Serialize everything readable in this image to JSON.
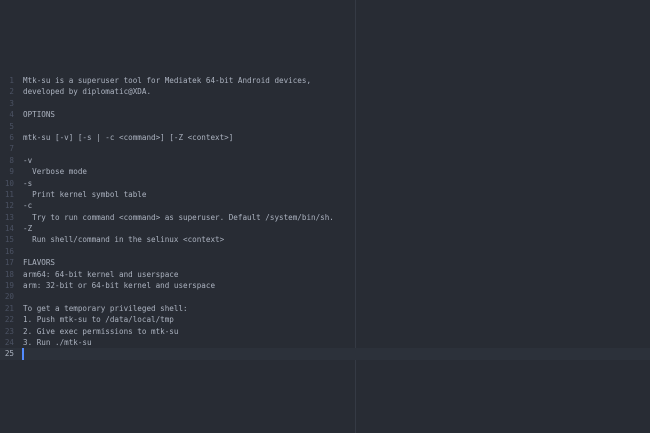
{
  "editor": {
    "lines": [
      {
        "num": "1",
        "text": "Mtk-su is a superuser tool for Mediatek 64-bit Android devices,"
      },
      {
        "num": "2",
        "text": "developed by diplomatic@XDA."
      },
      {
        "num": "3",
        "text": ""
      },
      {
        "num": "4",
        "text": "OPTIONS"
      },
      {
        "num": "5",
        "text": ""
      },
      {
        "num": "6",
        "text": "mtk-su [-v] [-s | -c <command>] [-Z <context>]"
      },
      {
        "num": "7",
        "text": ""
      },
      {
        "num": "8",
        "text": "-v"
      },
      {
        "num": "9",
        "text": "  Verbose mode"
      },
      {
        "num": "10",
        "text": "-s"
      },
      {
        "num": "11",
        "text": "  Print kernel symbol table"
      },
      {
        "num": "12",
        "text": "-c"
      },
      {
        "num": "13",
        "text": "  Try to run command <command> as superuser. Default /system/bin/sh."
      },
      {
        "num": "14",
        "text": "-Z"
      },
      {
        "num": "15",
        "text": "  Run shell/command in the selinux <context>"
      },
      {
        "num": "16",
        "text": ""
      },
      {
        "num": "17",
        "text": "FLAVORS"
      },
      {
        "num": "18",
        "text": "arm64: 64-bit kernel and userspace"
      },
      {
        "num": "19",
        "text": "arm: 32-bit or 64-bit kernel and userspace"
      },
      {
        "num": "20",
        "text": ""
      },
      {
        "num": "21",
        "text": "To get a temporary privileged shell:"
      },
      {
        "num": "22",
        "text": "1. Push mtk-su to /data/local/tmp"
      },
      {
        "num": "23",
        "text": "2. Give exec permissions to mtk-su"
      },
      {
        "num": "24",
        "text": "3. Run ./mtk-su"
      },
      {
        "num": "25",
        "text": ""
      }
    ],
    "active_line": 25
  },
  "colors": {
    "background": "#282c34",
    "text": "#abb2bf",
    "gutter": "#4b5263",
    "cursor": "#528bff"
  }
}
